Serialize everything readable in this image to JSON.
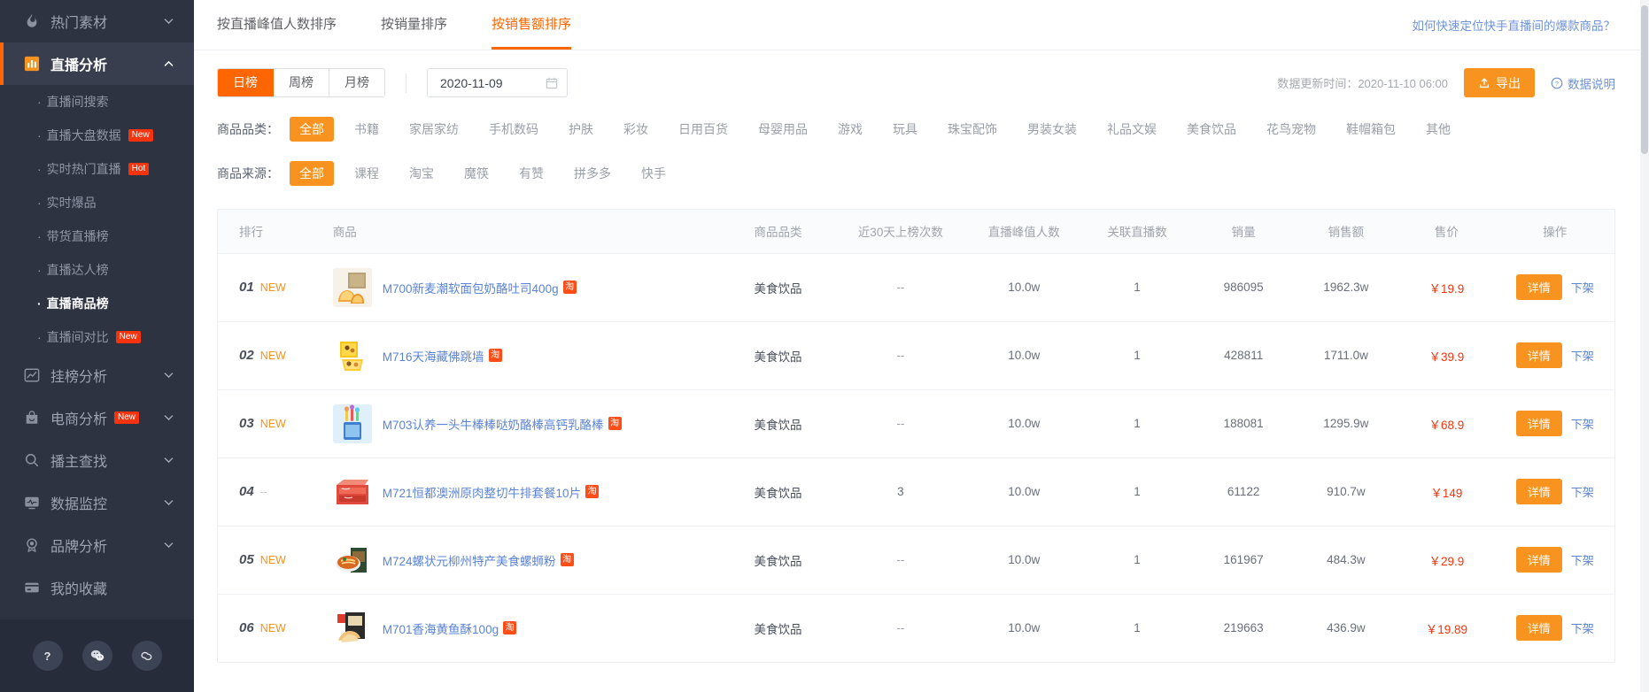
{
  "sidebar": {
    "groups": [
      {
        "label": "热门素材",
        "icon": "fire-icon",
        "active": false,
        "badge": "",
        "children": []
      },
      {
        "label": "直播分析",
        "icon": "bar-chart-icon",
        "active": true,
        "badge": "",
        "children": [
          {
            "label": "直播间搜索",
            "badge": "",
            "current": false
          },
          {
            "label": "直播大盘数据",
            "badge": "New",
            "current": false
          },
          {
            "label": "实时热门直播",
            "badge": "Hot",
            "current": false
          },
          {
            "label": "实时爆品",
            "badge": "",
            "current": false
          },
          {
            "label": "带货直播榜",
            "badge": "",
            "current": false
          },
          {
            "label": "直播达人榜",
            "badge": "",
            "current": false
          },
          {
            "label": "直播商品榜",
            "badge": "",
            "current": true
          },
          {
            "label": "直播间对比",
            "badge": "New",
            "current": false
          }
        ]
      },
      {
        "label": "挂榜分析",
        "icon": "trend-icon",
        "active": false,
        "badge": "",
        "children": []
      },
      {
        "label": "电商分析",
        "icon": "bag-icon",
        "active": false,
        "badge": "New",
        "children": []
      },
      {
        "label": "播主查找",
        "icon": "search-icon",
        "active": false,
        "badge": "",
        "children": []
      },
      {
        "label": "数据监控",
        "icon": "monitor-icon",
        "active": false,
        "badge": "",
        "children": []
      },
      {
        "label": "品牌分析",
        "icon": "medal-icon",
        "active": false,
        "badge": "",
        "children": []
      },
      {
        "label": "我的收藏",
        "icon": "card-icon",
        "active": false,
        "badge": "",
        "children": [],
        "noChevron": true
      }
    ],
    "footer_buttons": [
      "help-icon",
      "wechat-icon",
      "link-icon"
    ]
  },
  "tabs": [
    {
      "label": "按直播峰值人数排序",
      "active": false
    },
    {
      "label": "按销量排序",
      "active": false
    },
    {
      "label": "按销售额排序",
      "active": true
    }
  ],
  "help_link": "如何快速定位快手直播间的爆款商品？",
  "period": {
    "options": [
      {
        "label": "日榜",
        "active": true
      },
      {
        "label": "周榜",
        "active": false
      },
      {
        "label": "月榜",
        "active": false
      }
    ]
  },
  "date_picker": {
    "value": "2020-11-09",
    "icon": "calendar-icon"
  },
  "toolbar": {
    "update_time": "数据更新时间：2020-11-10 06:00",
    "export_label": "导出",
    "export_icon": "upload-icon",
    "data_desc_label": "数据说明",
    "data_desc_icon": "question-circle-icon"
  },
  "category_filter": {
    "label": "商品品类：",
    "items": [
      "全部",
      "书籍",
      "家居家纺",
      "手机数码",
      "护肤",
      "彩妆",
      "日用百货",
      "母婴用品",
      "游戏",
      "玩具",
      "珠宝配饰",
      "男装女装",
      "礼品文娱",
      "美食饮品",
      "花鸟宠物",
      "鞋帽箱包",
      "其他"
    ],
    "selected": "全部"
  },
  "source_filter": {
    "label": "商品来源：",
    "items": [
      "全部",
      "课程",
      "淘宝",
      "魔筷",
      "有赞",
      "拼多多",
      "快手"
    ],
    "selected": "全部"
  },
  "table": {
    "columns": [
      "排行",
      "商品",
      "商品品类",
      "近30天上榜次数",
      "直播峰值人数",
      "关联直播数",
      "销量",
      "销售额",
      "售价",
      "操作"
    ],
    "detail_label": "详情",
    "offshelf_label": "下架",
    "source_badge": "淘",
    "rows": [
      {
        "rank": "01",
        "rank_tag": "NEW",
        "product": "M700新麦潮软面包奶酪吐司400g",
        "category": "美食饮品",
        "days30": "--",
        "peak": "10.0w",
        "related": "1",
        "sales": "986095",
        "amount": "1962.3w",
        "price": "￥19.9",
        "thumb": "bread-thumb"
      },
      {
        "rank": "02",
        "rank_tag": "NEW",
        "product": "M716天海藏佛跳墙",
        "category": "美食饮品",
        "days30": "--",
        "peak": "10.0w",
        "related": "1",
        "sales": "428811",
        "amount": "1711.0w",
        "price": "￥39.9",
        "thumb": "giftbox-thumb"
      },
      {
        "rank": "03",
        "rank_tag": "NEW",
        "product": "M703认养一头牛棒棒哒奶酪棒高钙乳酪棒",
        "category": "美食饮品",
        "days30": "--",
        "peak": "10.0w",
        "related": "1",
        "sales": "188081",
        "amount": "1295.9w",
        "price": "￥68.9",
        "thumb": "cheese-thumb"
      },
      {
        "rank": "04",
        "rank_tag": "--",
        "product": "M721恒都澳洲原肉整切牛排套餐10片",
        "category": "美食饮品",
        "days30": "3",
        "peak": "10.0w",
        "related": "1",
        "sales": "61122",
        "amount": "910.7w",
        "price": "￥149",
        "thumb": "steak-thumb"
      },
      {
        "rank": "05",
        "rank_tag": "NEW",
        "product": "M724螺状元柳州特产美食螺蛳粉",
        "category": "美食饮品",
        "days30": "--",
        "peak": "10.0w",
        "related": "1",
        "sales": "161967",
        "amount": "484.3w",
        "price": "￥29.9",
        "thumb": "noodle-thumb"
      },
      {
        "rank": "06",
        "rank_tag": "NEW",
        "product": "M701香海黄鱼酥100g",
        "category": "美食饮品",
        "days30": "--",
        "peak": "10.0w",
        "related": "1",
        "sales": "219663",
        "amount": "436.9w",
        "price": "￥19.89",
        "thumb": "fish-thumb"
      }
    ]
  },
  "colors": {
    "accent_orange": "#f60",
    "button_orange": "#f7931e",
    "link_blue": "#5b84d6",
    "price_red": "#f5330c",
    "sidebar_bg": "#2e3342"
  }
}
